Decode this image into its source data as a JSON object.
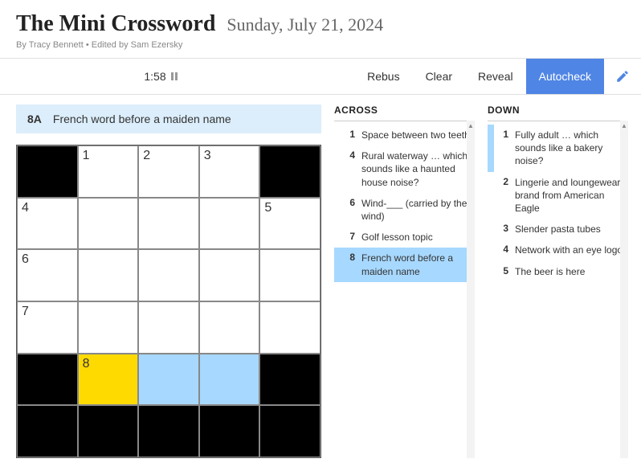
{
  "header": {
    "title": "The Mini Crossword",
    "date": "Sunday, July 21, 2024",
    "byline": "By Tracy Bennett • Edited by Sam Ezersky"
  },
  "toolbar": {
    "timer": "1:58",
    "rebus": "Rebus",
    "clear": "Clear",
    "reveal": "Reveal",
    "autocheck": "Autocheck"
  },
  "clue_bar": {
    "number": "8A",
    "text": "French word before a maiden name"
  },
  "grid": {
    "rows": 6,
    "cols": 5,
    "cells": [
      {
        "black": true
      },
      {
        "num": "1"
      },
      {
        "num": "2"
      },
      {
        "num": "3"
      },
      {
        "black": true
      },
      {
        "num": "4"
      },
      {},
      {},
      {},
      {
        "num": "5"
      },
      {
        "num": "6"
      },
      {},
      {},
      {},
      {},
      {
        "num": "7"
      },
      {},
      {},
      {},
      {},
      {
        "black": true
      },
      {
        "num": "8",
        "state": "active"
      },
      {
        "state": "highlight"
      },
      {
        "state": "highlight"
      },
      {
        "black": true
      },
      {
        "black": true
      },
      {
        "black": true
      },
      {
        "black": true
      },
      {
        "black": true
      },
      {
        "black": true
      }
    ]
  },
  "clues": {
    "across": {
      "header": "ACROSS",
      "items": [
        {
          "n": "1",
          "t": "Space between two teeth"
        },
        {
          "n": "4",
          "t": "Rural waterway … which sounds like a haunted house noise?"
        },
        {
          "n": "6",
          "t": "Wind-___ (carried by the wind)"
        },
        {
          "n": "7",
          "t": "Golf lesson topic"
        },
        {
          "n": "8",
          "t": "French word before a maiden name",
          "selected": true
        }
      ]
    },
    "down": {
      "header": "DOWN",
      "items": [
        {
          "n": "1",
          "t": "Fully adult … which sounds like a bakery noise?",
          "related": true
        },
        {
          "n": "2",
          "t": "Lingerie and loungewear brand from American Eagle"
        },
        {
          "n": "3",
          "t": "Slender pasta tubes"
        },
        {
          "n": "4",
          "t": "Network with an eye logo"
        },
        {
          "n": "5",
          "t": "The beer is here"
        }
      ]
    }
  }
}
